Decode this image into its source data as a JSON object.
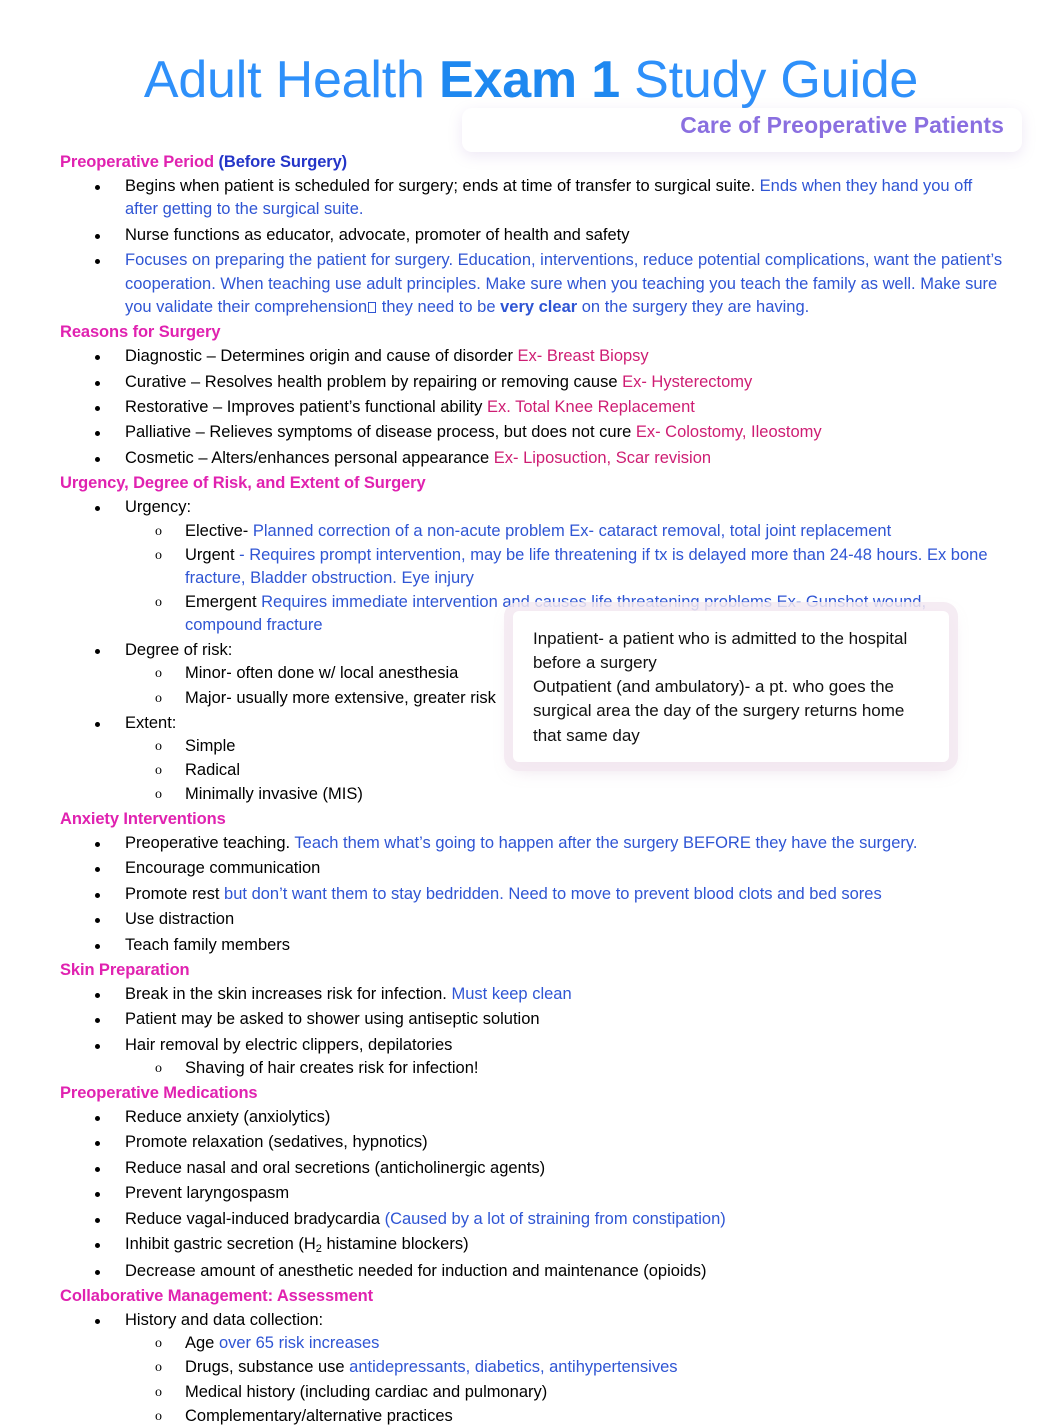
{
  "title": {
    "part1": "Adult Health ",
    "bold": "Exam 1",
    "part2": " Study Guide",
    "subtitle": "Care of Preoperative Patients",
    "color_primary": "#2E90FA",
    "color_subtitle": "#8A6FE0"
  },
  "colors": {
    "heading_pink": "#E022B0",
    "body_blue": "#2F55D4",
    "example_pink": "#CE1D73",
    "heading_blue": "#2435C8"
  },
  "sections": {
    "preoperative_period": {
      "heading_main": "Preoperative Period",
      "heading_sub": " (Before Surgery)",
      "b1_black": "Begins when patient is scheduled for surgery; ends at time of transfer to surgical suite. ",
      "b1_blue": "Ends when they hand you off after getting to the surgical suite.",
      "b2": "Nurse functions as educator, advocate, promoter of health and safety",
      "b3_blue_a": "Focuses on preparing the patient for surgery. Education, interventions, reduce potential complications, want the patient’s cooperation. When teaching use adult principles. Make sure when you teaching you teach the family as well. Make sure you validate their comprehension",
      "b3_blue_b": " they need to be ",
      "b3_bold": "very clear",
      "b3_blue_c": " on the surgery they are having."
    },
    "reasons_for_surgery": {
      "heading": "Reasons for Surgery",
      "items": [
        {
          "black": "Diagnostic – Determines origin and cause of disorder ",
          "pink": "Ex- Breast Biopsy"
        },
        {
          "black": "Curative – Resolves health problem by repairing or removing cause",
          "pink": " Ex- Hysterectomy"
        },
        {
          "black": "Restorative – Improves patient’s functional ability ",
          "pink": "Ex. Total Knee Replacement"
        },
        {
          "black": "Palliative – Relieves symptoms of disease process, but does not cure",
          "pink": " Ex- Colostomy, Ileostomy"
        },
        {
          "black": "Cosmetic – Alters/enhances personal appearance ",
          "pink": "Ex- Liposuction, Scar revision"
        }
      ]
    },
    "urgency": {
      "heading": "Urgency, Degree of Risk, and Extent of Surgery",
      "urgency_label": "Urgency:",
      "urgency_items": [
        {
          "black": "Elective- ",
          "blue": "Planned correction of a non-acute problem Ex- cataract removal, total joint replacement"
        },
        {
          "black": "Urgent ",
          "blue": "- Requires prompt intervention, may be life threatening if tx is delayed more than 24-48 hours. Ex bone fracture, Bladder obstruction. Eye injury"
        },
        {
          "black": "Emergent ",
          "blue": "Requires immediate intervention and causes life threatening problems Ex- Gunshot wound, compound fracture"
        }
      ],
      "risk_label": "Degree of risk:",
      "risk_items": [
        "Minor- often done w/ local anesthesia",
        "Major- usually more extensive, greater risk"
      ],
      "extent_label": "Extent:",
      "extent_items": [
        "Simple",
        "Radical",
        "Minimally invasive (MIS)"
      ]
    },
    "callout": {
      "line1": "Inpatient- a patient who is admitted to the hospital before a surgery",
      "line2": " Outpatient (and ambulatory)- a pt. who goes the surgical area the day of the surgery returns home that same day"
    },
    "anxiety": {
      "heading": "Anxiety Interventions",
      "items": [
        {
          "black": "Preoperative teaching. ",
          "blue": "Teach them what’s going to happen after the surgery BEFORE they have the surgery."
        },
        {
          "black": "Encourage communication",
          "blue": ""
        },
        {
          "black": "Promote rest ",
          "blue": "but don’t want them to stay bedridden. Need to move to prevent blood clots and bed sores"
        },
        {
          "black": "Use distraction",
          "blue": ""
        },
        {
          "black": "Teach family members",
          "blue": ""
        }
      ]
    },
    "skin_prep": {
      "heading": "Skin Preparation",
      "items": [
        {
          "black": "Break in the skin increases risk for infection. ",
          "blue": "Must keep clean"
        },
        {
          "black": "Patient may be asked to shower using antiseptic solution",
          "blue": ""
        },
        {
          "black": "Hair removal by electric clippers, depilatories",
          "blue": ""
        }
      ],
      "sub_item": "Shaving of hair creates risk for infection!"
    },
    "preop_meds": {
      "heading": "Preoperative Medications",
      "items": [
        {
          "black": "Reduce anxiety (anxiolytics)",
          "blue": ""
        },
        {
          "black": "Promote relaxation (sedatives, hypnotics)",
          "blue": ""
        },
        {
          "black": "Reduce nasal and oral secretions (anticholinergic agents)",
          "blue": ""
        },
        {
          "black": "Prevent laryngospasm",
          "blue": ""
        },
        {
          "black": "Reduce vagal-induced bradycardia ",
          "blue": "(Caused by a lot of straining from constipation)"
        }
      ],
      "gastric_pre": "Inhibit gastric secretion (H",
      "gastric_sub": "2",
      "gastric_post": " histamine blockers)",
      "last_item": "Decrease amount of anesthetic needed for induction and maintenance (opioids)"
    },
    "collaborative": {
      "heading": "Collaborative Management: Assessment",
      "parent": "History and data collection:",
      "items": [
        {
          "black": "Age ",
          "blue": "over 65 risk increases"
        },
        {
          "black": "Drugs, substance use ",
          "blue": "antidepressants, diabetics, antihypertensives"
        },
        {
          "black": "Medical history (including cardiac and pulmonary)",
          "blue": ""
        },
        {
          "black": "Complementary/alternative practices",
          "blue": ""
        }
      ]
    }
  }
}
